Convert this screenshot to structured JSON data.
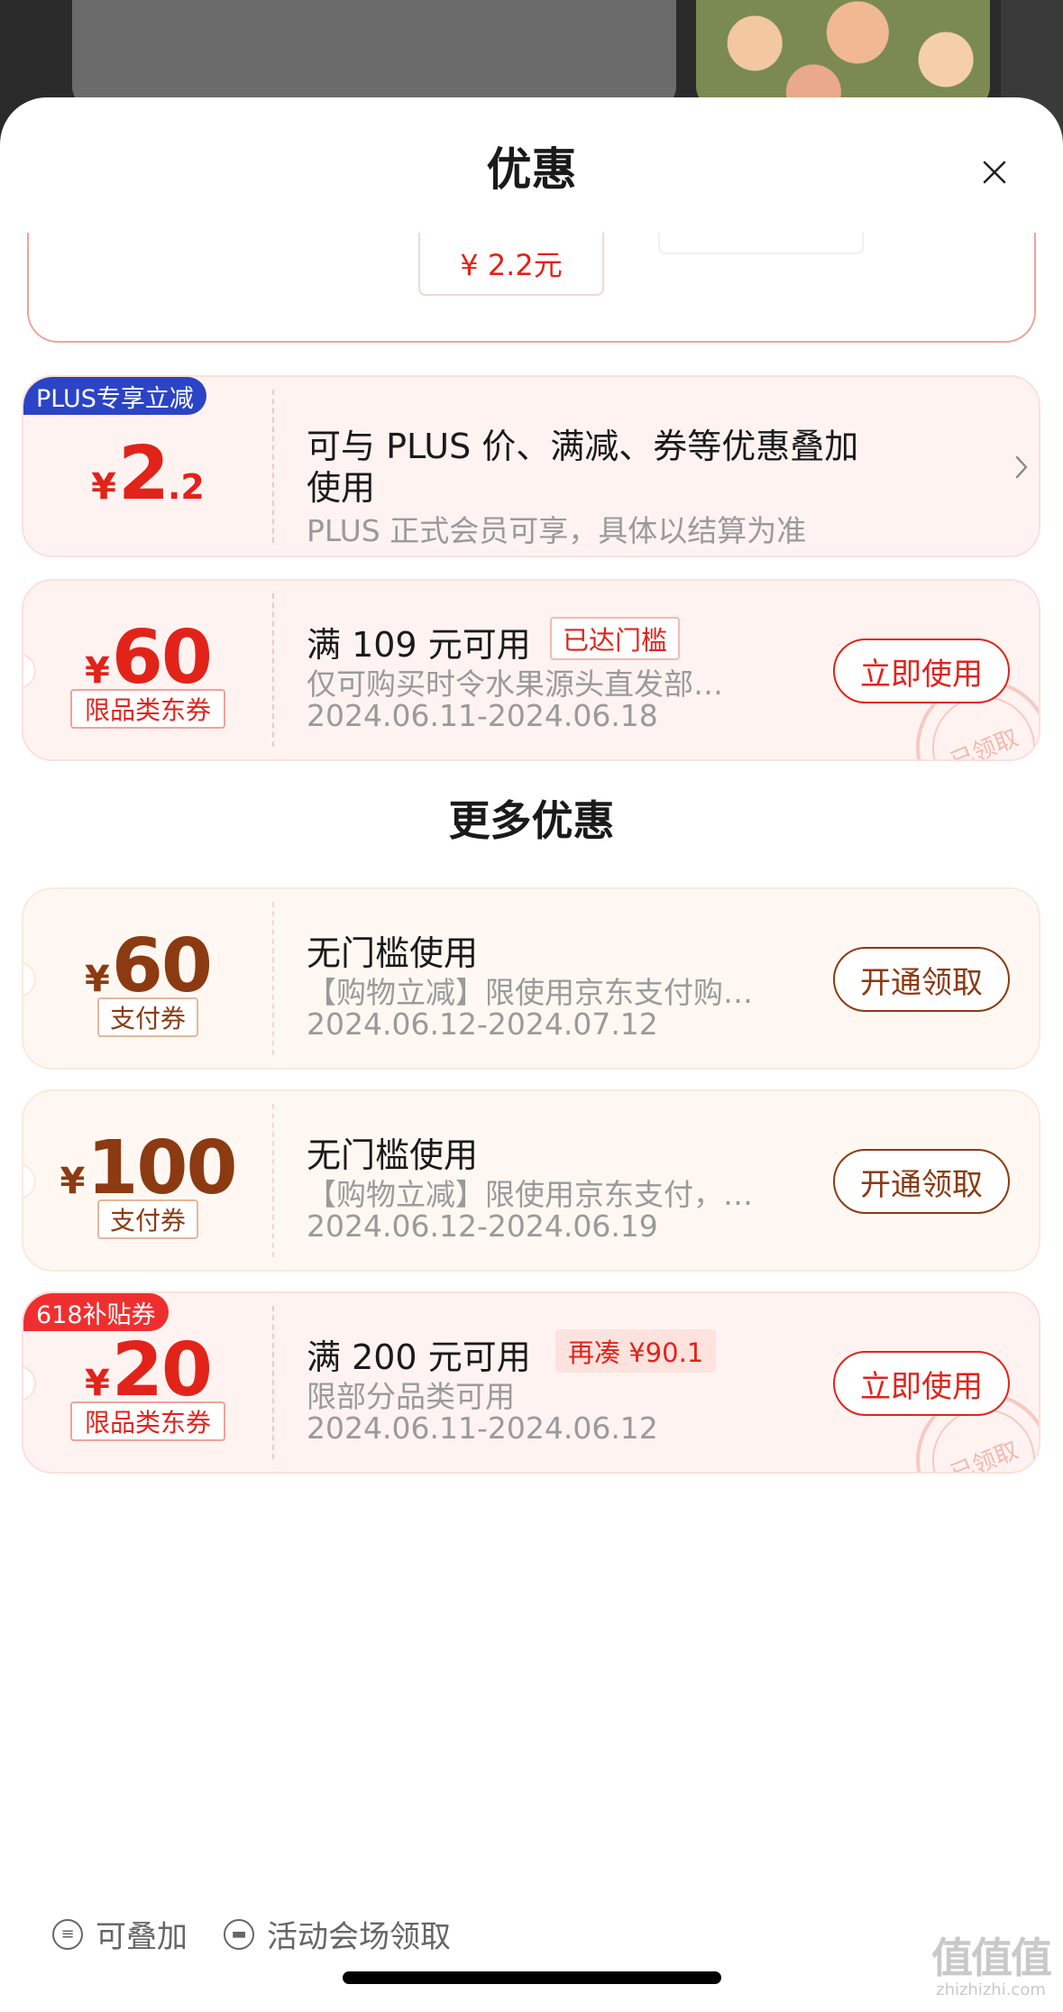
{
  "sheet": {
    "title": "优惠",
    "close_icon": "close-icon"
  },
  "partial": {
    "chip_text": "¥ 2.2元"
  },
  "plus_coupon": {
    "badge": "PLUS专享立减",
    "currency": "¥",
    "amount_int": "2",
    "amount_dec": ".2",
    "title_line1": "可与 PLUS 价、满减、券等优惠叠加",
    "title_line2": "使用",
    "desc": "PLUS 正式会员可享，具体以结算为准"
  },
  "coupons": [
    {
      "currency": "¥",
      "amount": "60",
      "kind": "限品类东券",
      "title": "满 109 元可用",
      "status": "已达门槛",
      "desc": "仅可购买时令水果源头直发部…",
      "date": "2024.06.11-2024.06.18",
      "action": "立即使用",
      "stamp": "已领取"
    }
  ],
  "more_section": {
    "title": "更多优惠"
  },
  "more_coupons": [
    {
      "currency": "¥",
      "amount": "60",
      "kind": "支付券",
      "title": "无门槛使用",
      "desc": "【购物立减】限使用京东支付购…",
      "date": "2024.06.12-2024.07.12",
      "action": "开通领取"
    },
    {
      "currency": "¥",
      "amount": "100",
      "kind": "支付券",
      "title": "无门槛使用",
      "desc": "【购物立减】限使用京东支付，…",
      "date": "2024.06.12-2024.06.19",
      "action": "开通领取"
    },
    {
      "badge": "618补贴券",
      "currency": "¥",
      "amount": "20",
      "kind": "限品类东券",
      "title": "满 200 元可用",
      "status": "再凑 ¥90.1",
      "desc": "限部分品类可用",
      "date": "2024.06.11-2024.06.12",
      "action": "立即使用",
      "stamp": "已领取"
    }
  ],
  "legend": {
    "stackable": "可叠加",
    "venue": "活动会场领取"
  },
  "watermark": {
    "big": "值值值",
    "small": "zhizhizhi.com"
  },
  "colors": {
    "accent_red": "#e2231a",
    "pay_brown": "#8c3a12",
    "plus_blue": "#2b44c6"
  }
}
